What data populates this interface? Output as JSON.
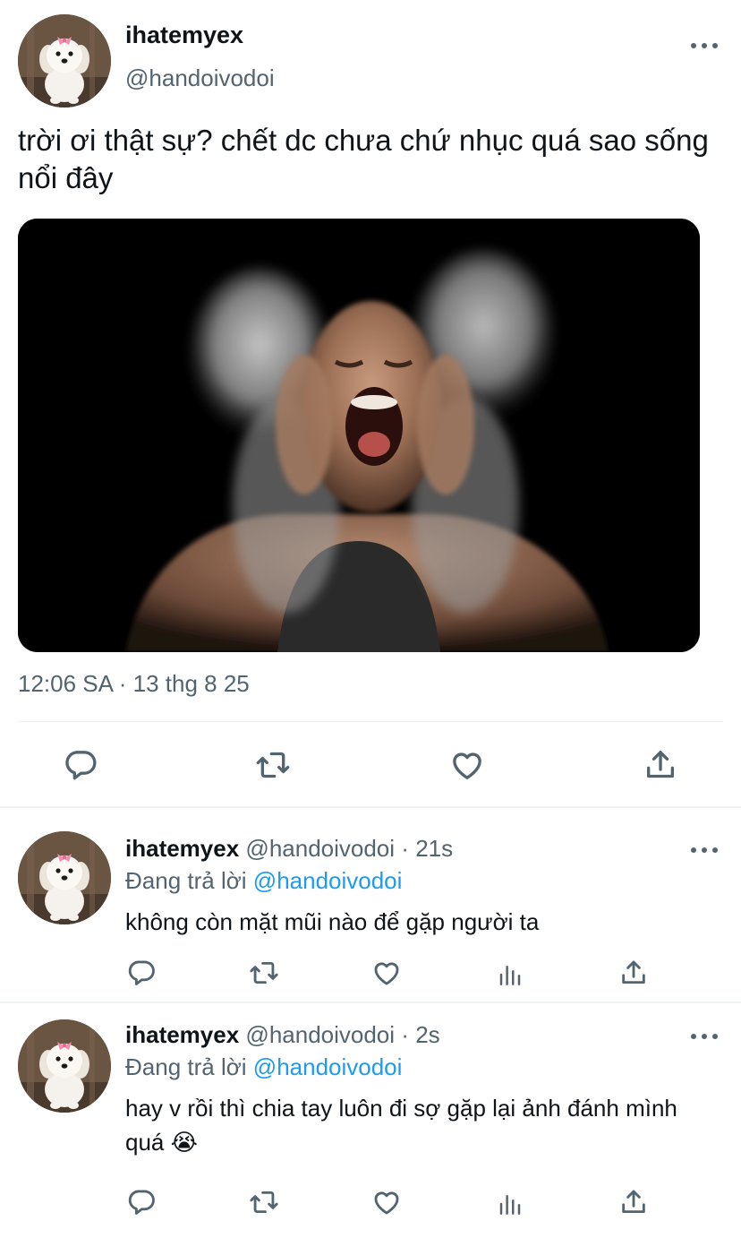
{
  "main_tweet": {
    "display_name": "ihatemyex",
    "handle": "@handoivodoi",
    "text": "trời ơi thật sự? chết dc chưa chứ nhục quá sao sống nổi đây",
    "timestamp": "12:06 SA · 13 thg 8 25",
    "actions": [
      "reply-icon",
      "retweet-icon",
      "like-icon",
      "share-icon"
    ]
  },
  "replies": [
    {
      "display_name": "ihatemyex",
      "handle": "@handoivodoi",
      "dot": "·",
      "time": "21s",
      "replying_prefix": "Đang trả lời",
      "replying_to": "@handoivodoi",
      "text": "không còn mặt mũi nào để gặp người ta",
      "actions": [
        "reply-icon",
        "retweet-icon",
        "like-icon",
        "views-icon",
        "share-icon"
      ]
    },
    {
      "display_name": "ihatemyex",
      "handle": "@handoivodoi",
      "dot": "·",
      "time": "2s",
      "replying_prefix": "Đang trả lời",
      "replying_to": "@handoivodoi",
      "text": "hay v rồi thì chia tay luôn đi sợ gặp lại ảnh đánh mình quá 😭",
      "actions": [
        "reply-icon",
        "retweet-icon",
        "like-icon",
        "views-icon",
        "share-icon"
      ]
    }
  ],
  "colors": {
    "text": "#0f1419",
    "secondary": "#536471",
    "link": "#1d9bf0",
    "divider": "#eff3f4",
    "media_bg": "#000000"
  }
}
